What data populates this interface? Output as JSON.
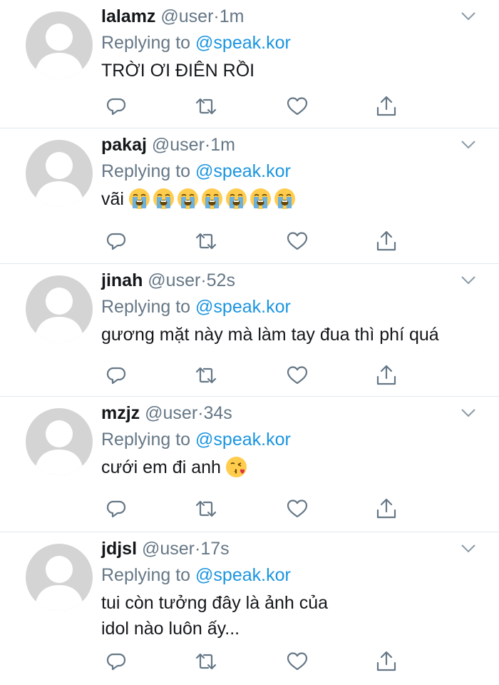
{
  "tweets": [
    {
      "name": "lalamz",
      "handle": "@user",
      "sep": "·",
      "time": "1m",
      "replying_prefix": "Replying to",
      "replying_to": "@speak.kor",
      "text": "TRỜI ƠI ĐIÊN RỒI"
    },
    {
      "name": "pakaj",
      "handle": "@user",
      "sep": "·",
      "time": "1m",
      "replying_prefix": "Replying to",
      "replying_to": "@speak.kor",
      "text": "vãi",
      "emoji": "loudly-crying-face",
      "emoji_count": 7
    },
    {
      "name": "jinah",
      "handle": "@user",
      "sep": "·",
      "time": "52s",
      "replying_prefix": "Replying to",
      "replying_to": "@speak.kor",
      "text": "gương mặt này mà làm tay đua thì phí quá"
    },
    {
      "name": "mzjz",
      "handle": "@user",
      "sep": "·",
      "time": "34s",
      "replying_prefix": "Replying to",
      "replying_to": "@speak.kor",
      "text": "cưới em đi anh",
      "emoji": "face-blowing-a-kiss",
      "emoji_count": 1
    },
    {
      "name": "jdjsl",
      "handle": "@user",
      "sep": "·",
      "time": "17s",
      "replying_prefix": "Replying to",
      "replying_to": "@speak.kor",
      "text": "tui còn tưởng đây là ảnh của idol nào luôn ấy..."
    }
  ],
  "colors": {
    "link": "#1b95e0",
    "secondary": "#657786",
    "avatar": "#d4d4d4",
    "divider": "#e1e8ed"
  },
  "icons": [
    "reply-icon",
    "retweet-icon",
    "like-icon",
    "share-icon",
    "chevron-down-icon"
  ]
}
